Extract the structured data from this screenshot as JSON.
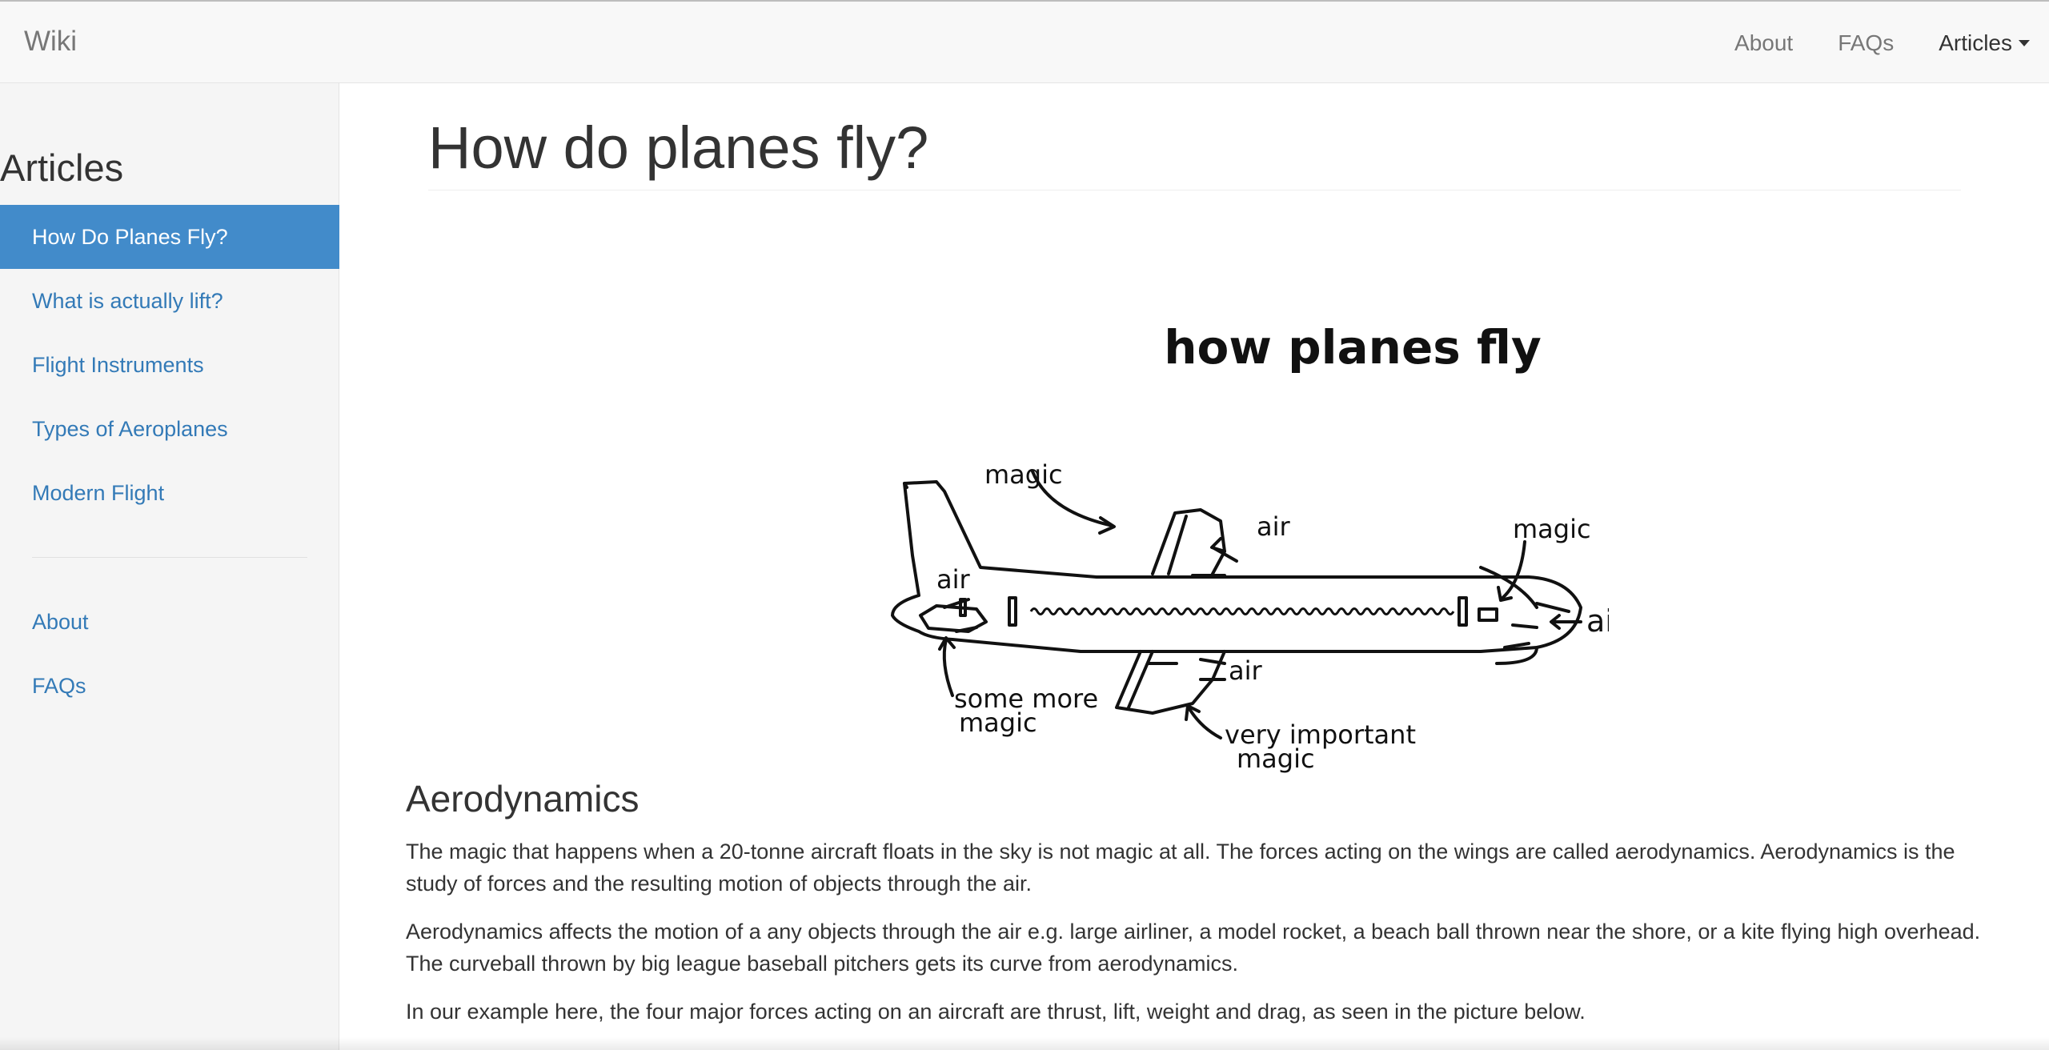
{
  "navbar": {
    "brand": "Wiki",
    "links": [
      {
        "label": "About"
      },
      {
        "label": "FAQs"
      },
      {
        "label": "Articles"
      }
    ]
  },
  "sidebar": {
    "heading": "Articles",
    "items": [
      {
        "label": "How Do Planes Fly?",
        "active": true
      },
      {
        "label": "What is actually lift?"
      },
      {
        "label": "Flight Instruments"
      },
      {
        "label": "Types of Aeroplanes"
      },
      {
        "label": "Modern Flight"
      }
    ],
    "secondary_items": [
      {
        "label": "About"
      },
      {
        "label": "FAQs"
      }
    ]
  },
  "article": {
    "title": "How do planes fly?",
    "figure": {
      "caption": "how planes fly",
      "labels": {
        "magic_top": "magic",
        "air_wing": "air",
        "magic_nose": "magic",
        "air_tail": "air",
        "air_nose": "air",
        "air_lower_wing": "air",
        "some_more": "some more",
        "some_more_magic": "magic",
        "very_important": "very important",
        "very_important_magic": "magic"
      }
    },
    "section_heading": "Aerodynamics",
    "paragraphs": [
      "The magic that happens when a 20-tonne aircraft floats in the sky is not magic at all. The forces acting on the wings are called aerodynamics. Aerodynamics is the study of forces and the resulting motion of objects through the air.",
      "Aerodynamics affects the motion of a any objects through the air e.g. large airliner, a model rocket, a beach ball thrown near the shore, or a kite flying high overhead. The curveball thrown by big league baseball pitchers gets its curve from aerodynamics.",
      "In our example here, the four major forces acting on an aircraft are thrust, lift, weight and drag, as seen in the picture below."
    ]
  },
  "colors": {
    "link": "#337ab7",
    "active_bg": "#428bca",
    "navbar_bg": "#f8f8f8",
    "sidebar_bg": "#f5f5f5",
    "text": "#333333",
    "muted": "#777777"
  }
}
